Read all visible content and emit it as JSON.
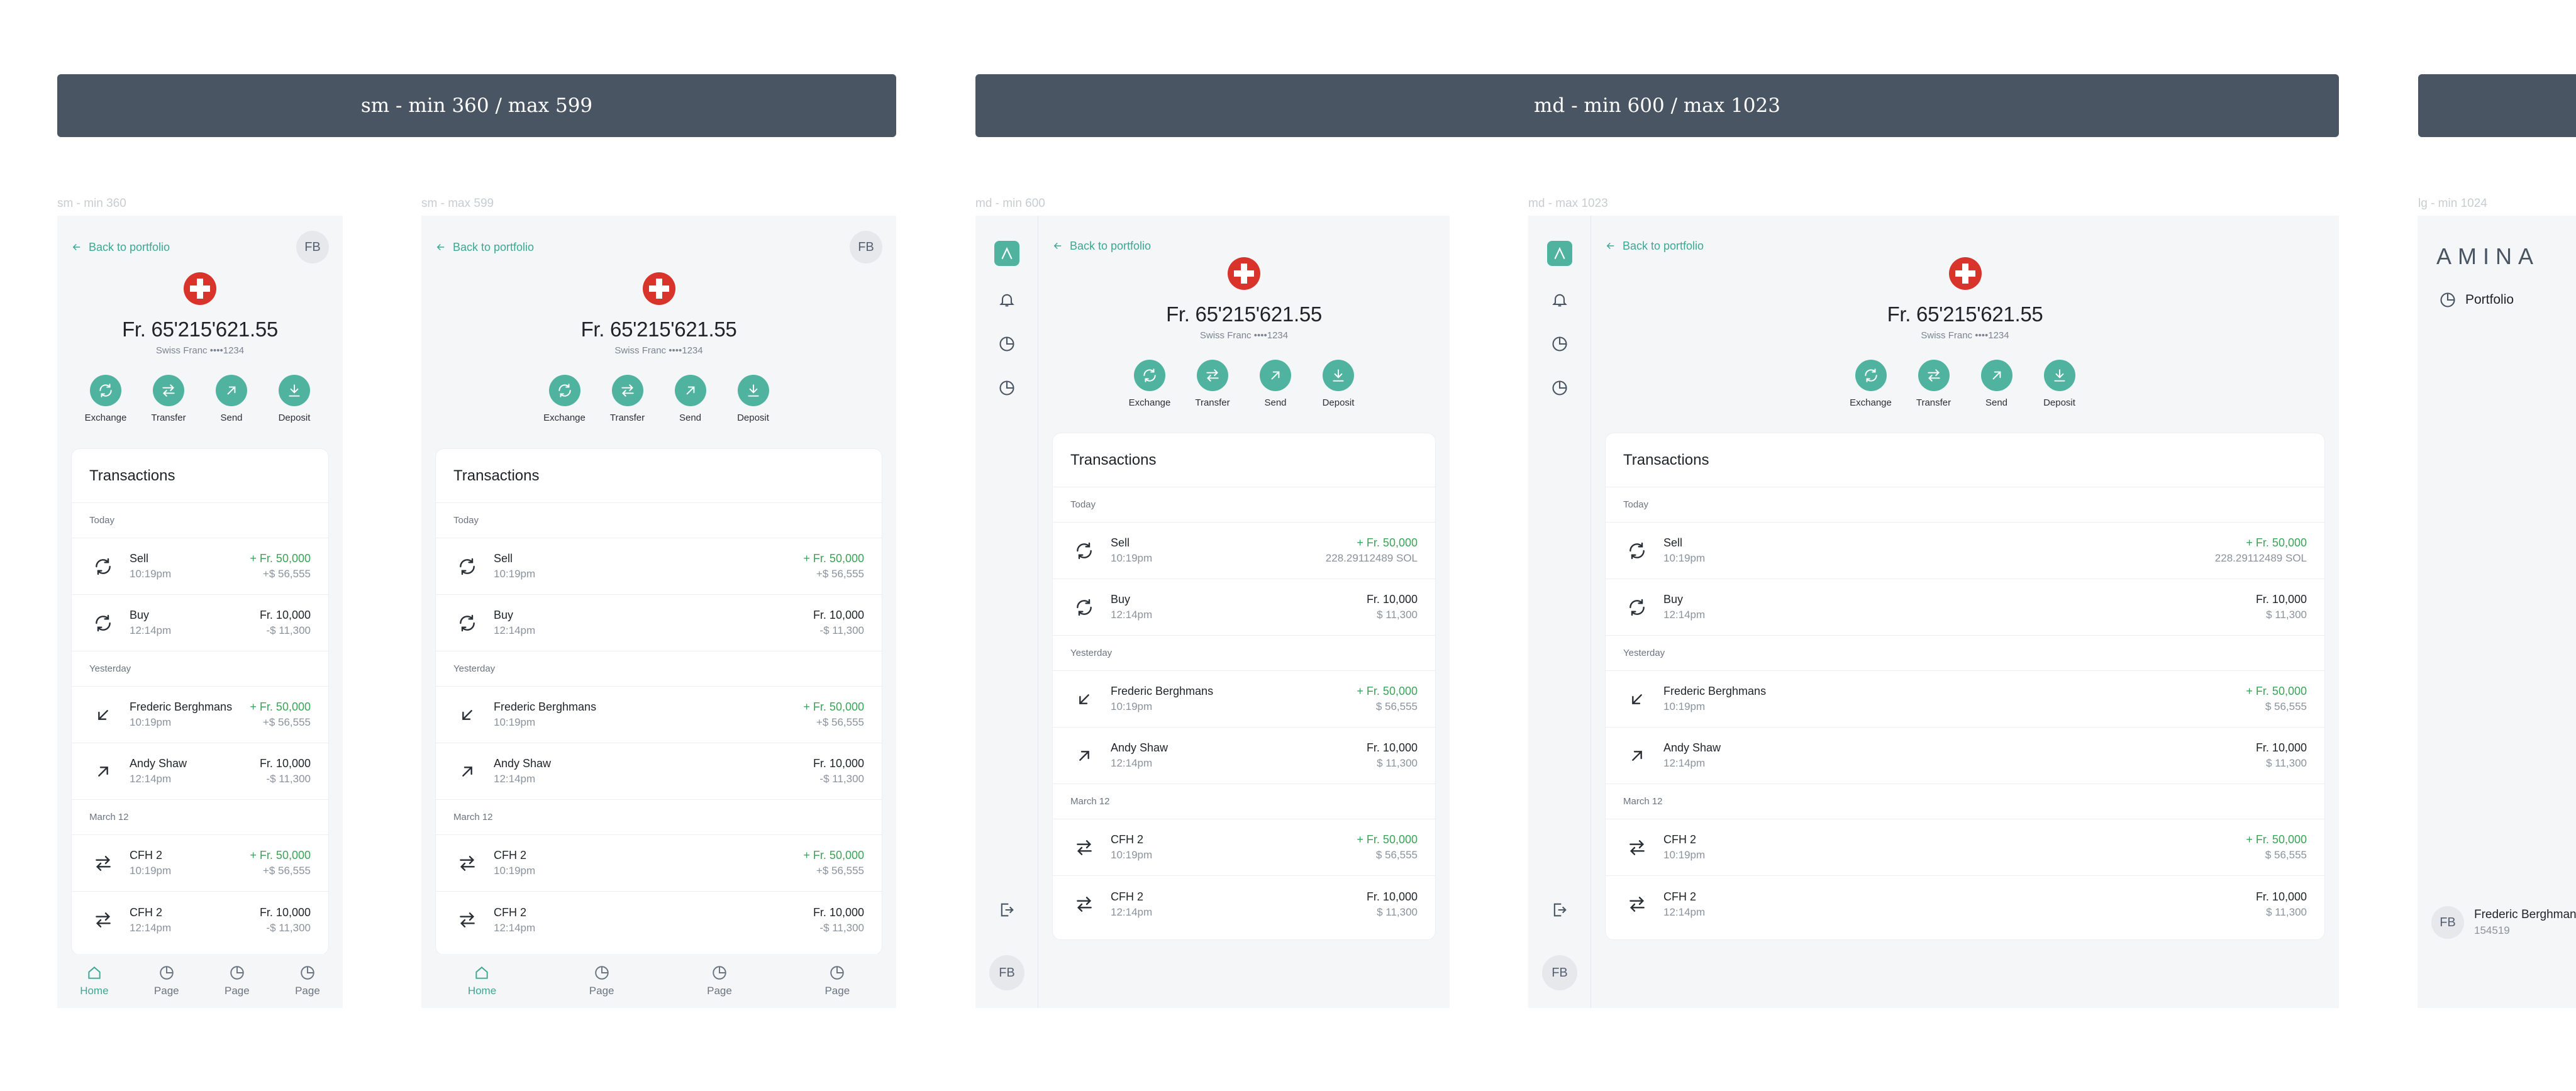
{
  "breakpoints": {
    "sm": "sm - min 360 / max 599",
    "md": "md - min 600 / max 1023"
  },
  "frames": {
    "sm_min": "sm - min 360",
    "sm_max": "sm - max 599",
    "md_min": "md - min 600",
    "md_max": "md - max 1023",
    "lg_min": "lg - min 1024"
  },
  "app": {
    "back_label": "Back to portfolio",
    "avatar_initials": "FB",
    "balance": "Fr. 65'215'621.55",
    "account": "Swiss Franc ••••1234",
    "actions": [
      "Exchange",
      "Transfer",
      "Send",
      "Deposit"
    ],
    "transactions_title": "Transactions",
    "nav": [
      "Home",
      "Page",
      "Page",
      "Page"
    ],
    "groups": [
      "Today",
      "Yesterday",
      "March 12"
    ],
    "sm_tx": [
      {
        "name": "Sell",
        "time": "10:19pm",
        "a1": "+ Fr. 50,000",
        "a2": "+$ 56,555",
        "pos": true
      },
      {
        "name": "Buy",
        "time": "12:14pm",
        "a1": "Fr. 10,000",
        "a2": "-$ 11,300",
        "pos": false
      },
      {
        "name": "Frederic Berghmans",
        "time": "10:19pm",
        "a1": "+ Fr. 50,000",
        "a2": "+$ 56,555",
        "pos": true
      },
      {
        "name": "Andy Shaw",
        "time": "12:14pm",
        "a1": "Fr. 10,000",
        "a2": "-$ 11,300",
        "pos": false
      },
      {
        "name": "CFH 2",
        "time": "10:19pm",
        "a1": "+ Fr. 50,000",
        "a2": "+$ 56,555",
        "pos": true
      },
      {
        "name": "CFH 2",
        "time": "12:14pm",
        "a1": "Fr. 10,000",
        "a2": "-$ 11,300",
        "pos": false
      }
    ],
    "md_tx": [
      {
        "name": "Sell",
        "time": "10:19pm",
        "a1": "+ Fr. 50,000",
        "a2": "228.29112489 SOL",
        "pos": true
      },
      {
        "name": "Buy",
        "time": "12:14pm",
        "a1": "Fr. 10,000",
        "a2": "$ 11,300",
        "pos": false
      },
      {
        "name": "Frederic Berghmans",
        "time": "10:19pm",
        "a1": "+ Fr. 50,000",
        "a2": "$ 56,555",
        "pos": true
      },
      {
        "name": "Andy Shaw",
        "time": "12:14pm",
        "a1": "Fr. 10,000",
        "a2": "$ 11,300",
        "pos": false
      },
      {
        "name": "CFH 2",
        "time": "10:19pm",
        "a1": "+ Fr. 50,000",
        "a2": "$ 56,555",
        "pos": true
      },
      {
        "name": "CFH 2",
        "time": "12:14pm",
        "a1": "Fr. 10,000",
        "a2": "$ 11,300",
        "pos": false
      }
    ]
  },
  "lg": {
    "wordmark": "AMINA",
    "nav_portfolio": "Portfolio",
    "user_initials": "FB",
    "user_name": "Frederic Berghmans",
    "user_id": "154519"
  },
  "colors": {
    "accent": "#4fb3a0",
    "header": "#4a5563",
    "positive": "#3aa357",
    "flag": "#d9342b"
  },
  "icons": {
    "tx": [
      "exchange-icon",
      "exchange-icon",
      "arrow-down-left-icon",
      "arrow-up-right-icon",
      "transfer-icon",
      "transfer-icon"
    ]
  }
}
